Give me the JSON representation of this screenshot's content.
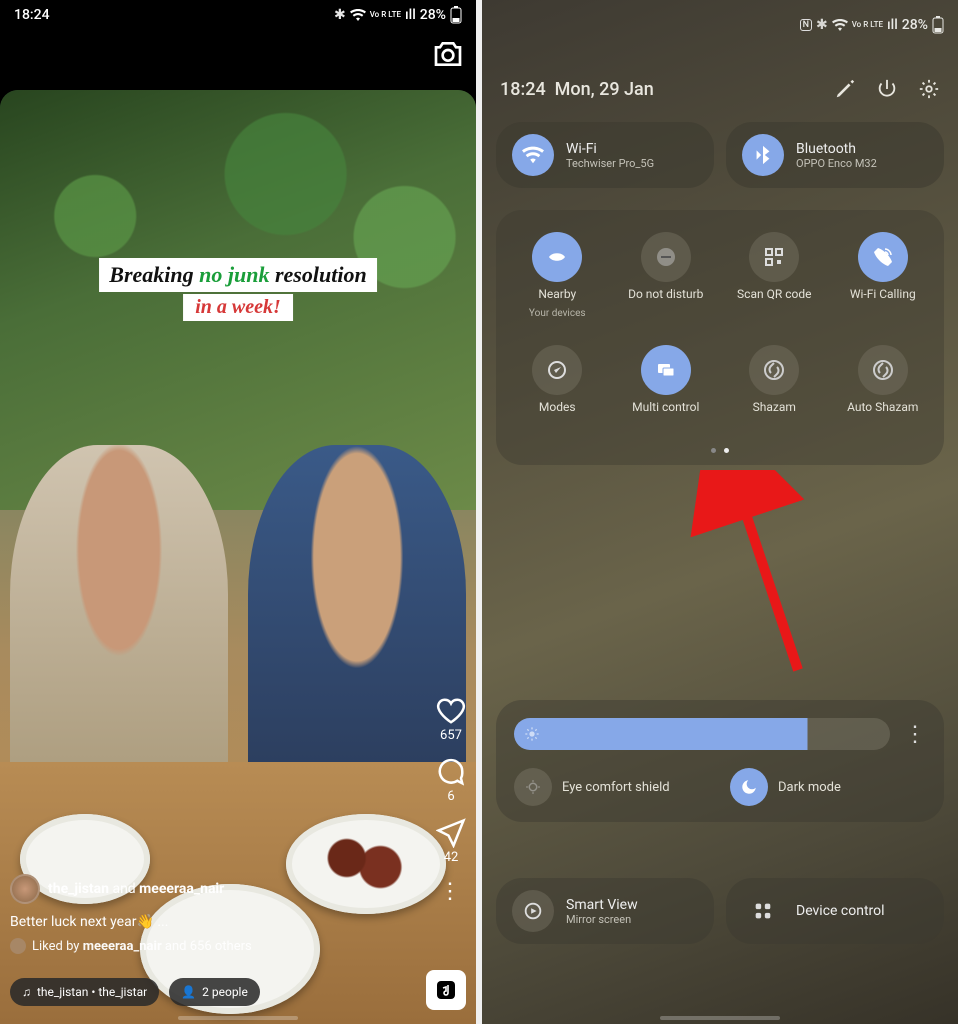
{
  "left_phone": {
    "statusbar": {
      "time": "18:24",
      "battery": "28%",
      "net": "Vo R LTE",
      "signal": "ıll"
    },
    "story_text": {
      "line1_a": "Breaking ",
      "line1_green": "no junk",
      "line1_b": " resolution",
      "line2": "in a week!"
    },
    "likes": "657",
    "comments": "6",
    "shares": "42",
    "user1": "the_jistan",
    "user2": "meeeraa_nair",
    "user_joiner": " and ",
    "caption": "Better luck next year👋 ...",
    "liked_prefix": "Liked by ",
    "liked_by": "meeeraa_nair",
    "liked_suffix": " and 656 others",
    "audio_chip": "the_jistan • the_jistar",
    "people_chip": "2 people"
  },
  "right_phone": {
    "statusbar": {
      "battery": "28%",
      "net": "Vo R LTE",
      "signal": "ıll"
    },
    "header": {
      "time": "18:24",
      "date": "Mon, 29 Jan"
    },
    "wifi": {
      "title": "Wi-Fi",
      "sub": "Techwiser Pro_5G"
    },
    "bluetooth": {
      "title": "Bluetooth",
      "sub": "OPPO Enco M32"
    },
    "tiles": [
      {
        "label": "Nearby",
        "sub": "Your devices",
        "on": true,
        "icon": "nearby"
      },
      {
        "label": "Do not disturb",
        "sub": "",
        "on": false,
        "icon": "dnd"
      },
      {
        "label": "Scan QR code",
        "sub": "",
        "on": false,
        "icon": "qr"
      },
      {
        "label": "Wi-Fi Calling",
        "sub": "",
        "on": true,
        "icon": "wificall"
      },
      {
        "label": "Modes",
        "sub": "",
        "on": false,
        "icon": "modes"
      },
      {
        "label": "Multi control",
        "sub": "",
        "on": true,
        "icon": "multi"
      },
      {
        "label": "Shazam",
        "sub": "",
        "on": false,
        "icon": "shazam"
      },
      {
        "label": "Auto Shazam",
        "sub": "",
        "on": false,
        "icon": "shazam"
      }
    ],
    "brightness_pct": 78,
    "eye_comfort": {
      "label": "Eye comfort shield",
      "on": false
    },
    "dark_mode": {
      "label": "Dark mode",
      "on": true
    },
    "smartview": {
      "title": "Smart View",
      "sub": "Mirror screen"
    },
    "device_control": {
      "title": "Device control"
    }
  }
}
